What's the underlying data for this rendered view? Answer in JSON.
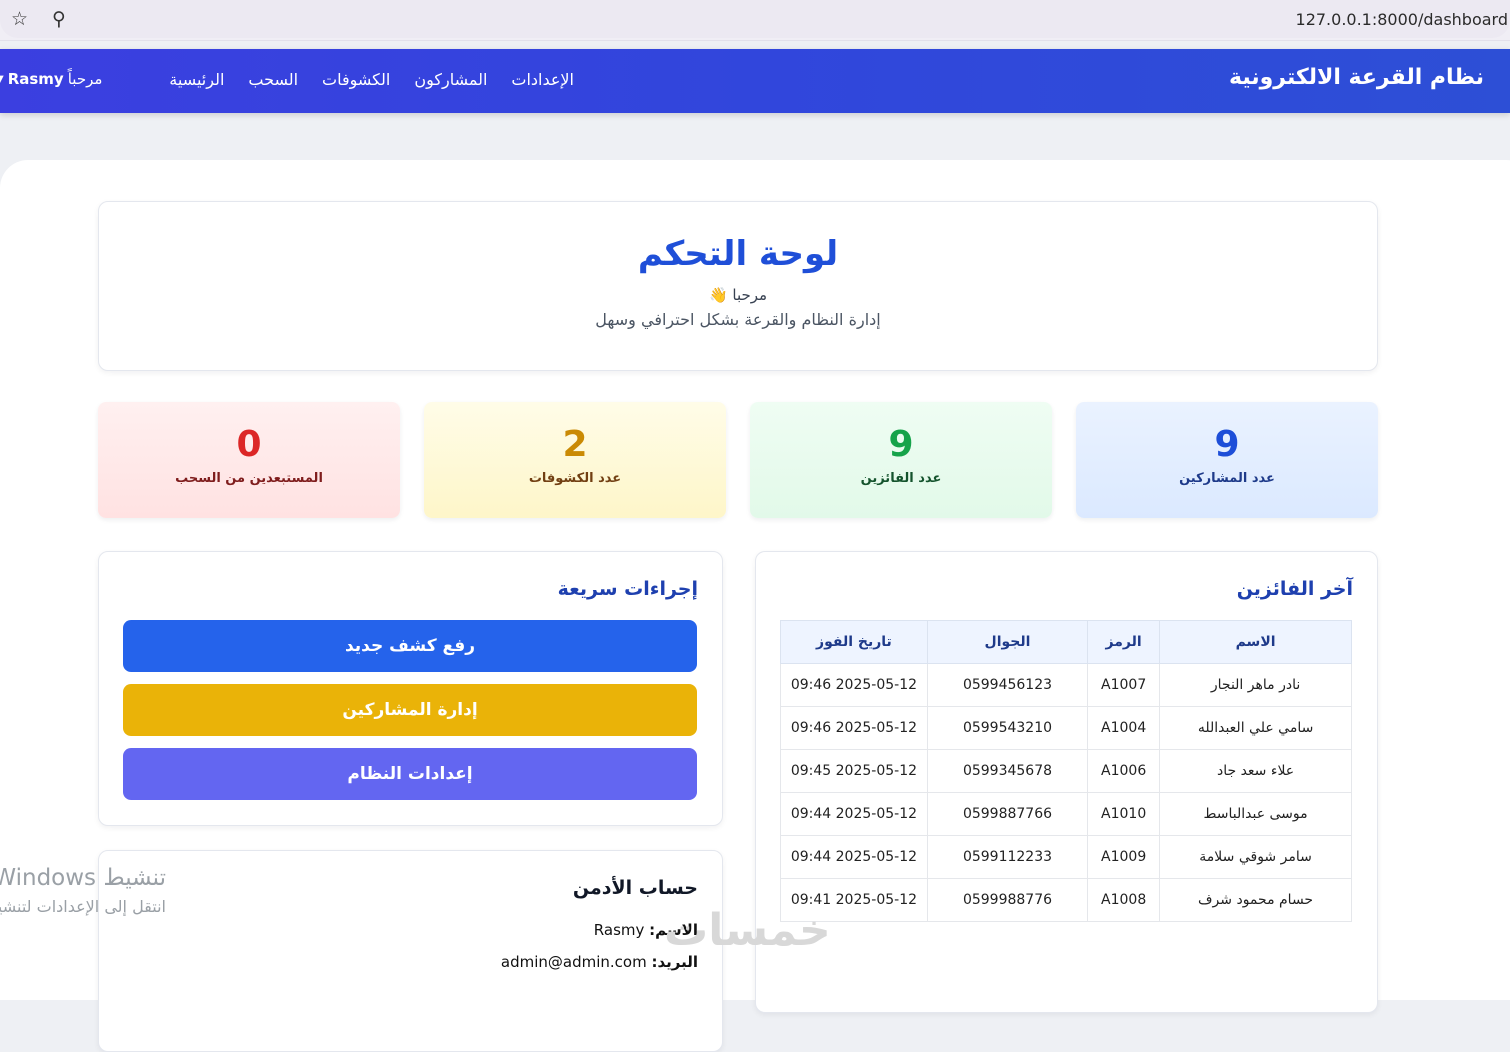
{
  "browser": {
    "url": "127.0.0.1:8000/dashboard",
    "icons": [
      "star-icon",
      "zoom-icon"
    ]
  },
  "navbar": {
    "brand": "نظام القرعة الالكترونية",
    "links": [
      "الرئيسية",
      "السحب",
      "الكشوفات",
      "المشاركون",
      "الإعدادات"
    ],
    "user_greeting": "مرحباً",
    "user_name": "Rasmy"
  },
  "header": {
    "title": "لوحة التحكم",
    "welcome": "مرحبا 👋",
    "subtitle": "إدارة النظام والقرعة بشكل احترافي وسهل"
  },
  "stats": {
    "participants": {
      "value": "9",
      "label": "عدد المشاركين"
    },
    "winners": {
      "value": "9",
      "label": "عدد الفائزين"
    },
    "sheets": {
      "value": "2",
      "label": "عدد الكشوفات"
    },
    "excluded": {
      "value": "0",
      "label": "المستبعدين من السحب"
    }
  },
  "latest_winners": {
    "title": "آخر الفائزين",
    "columns": [
      "الاسم",
      "الرمز",
      "الجوال",
      "تاريخ الفوز"
    ],
    "rows": [
      [
        "نادر ماهر النجار",
        "A1007",
        "0599456123",
        "2025-05-12 09:46"
      ],
      [
        "سامي علي العبدالله",
        "A1004",
        "0599543210",
        "2025-05-12 09:46"
      ],
      [
        "علاء سعد جاد",
        "A1006",
        "0599345678",
        "2025-05-12 09:45"
      ],
      [
        "موسى عبدالباسط",
        "A1010",
        "0599887766",
        "2025-05-12 09:44"
      ],
      [
        "سامر شوقي سلامة",
        "A1009",
        "0599112233",
        "2025-05-12 09:44"
      ],
      [
        "حسام محمود شرف",
        "A1008",
        "0599988776",
        "2025-05-12 09:41"
      ]
    ]
  },
  "quick_actions": {
    "title": "إجراءات سريعة",
    "upload": "رفع كشف جديد",
    "manage": "إدارة المشاركين",
    "settings": "إعدادات النظام"
  },
  "admin": {
    "title": "حساب الأدمن",
    "name_label": "الاسم:",
    "name_value": "Rasmy",
    "email_label": "البريد:",
    "email_value": "admin@admin.com"
  },
  "overlay": {
    "activation_title": "تنشيط Windows",
    "activation_hint": "انتقل إلى الإعدادات لتنشيط",
    "site_logo": "خمسات"
  }
}
